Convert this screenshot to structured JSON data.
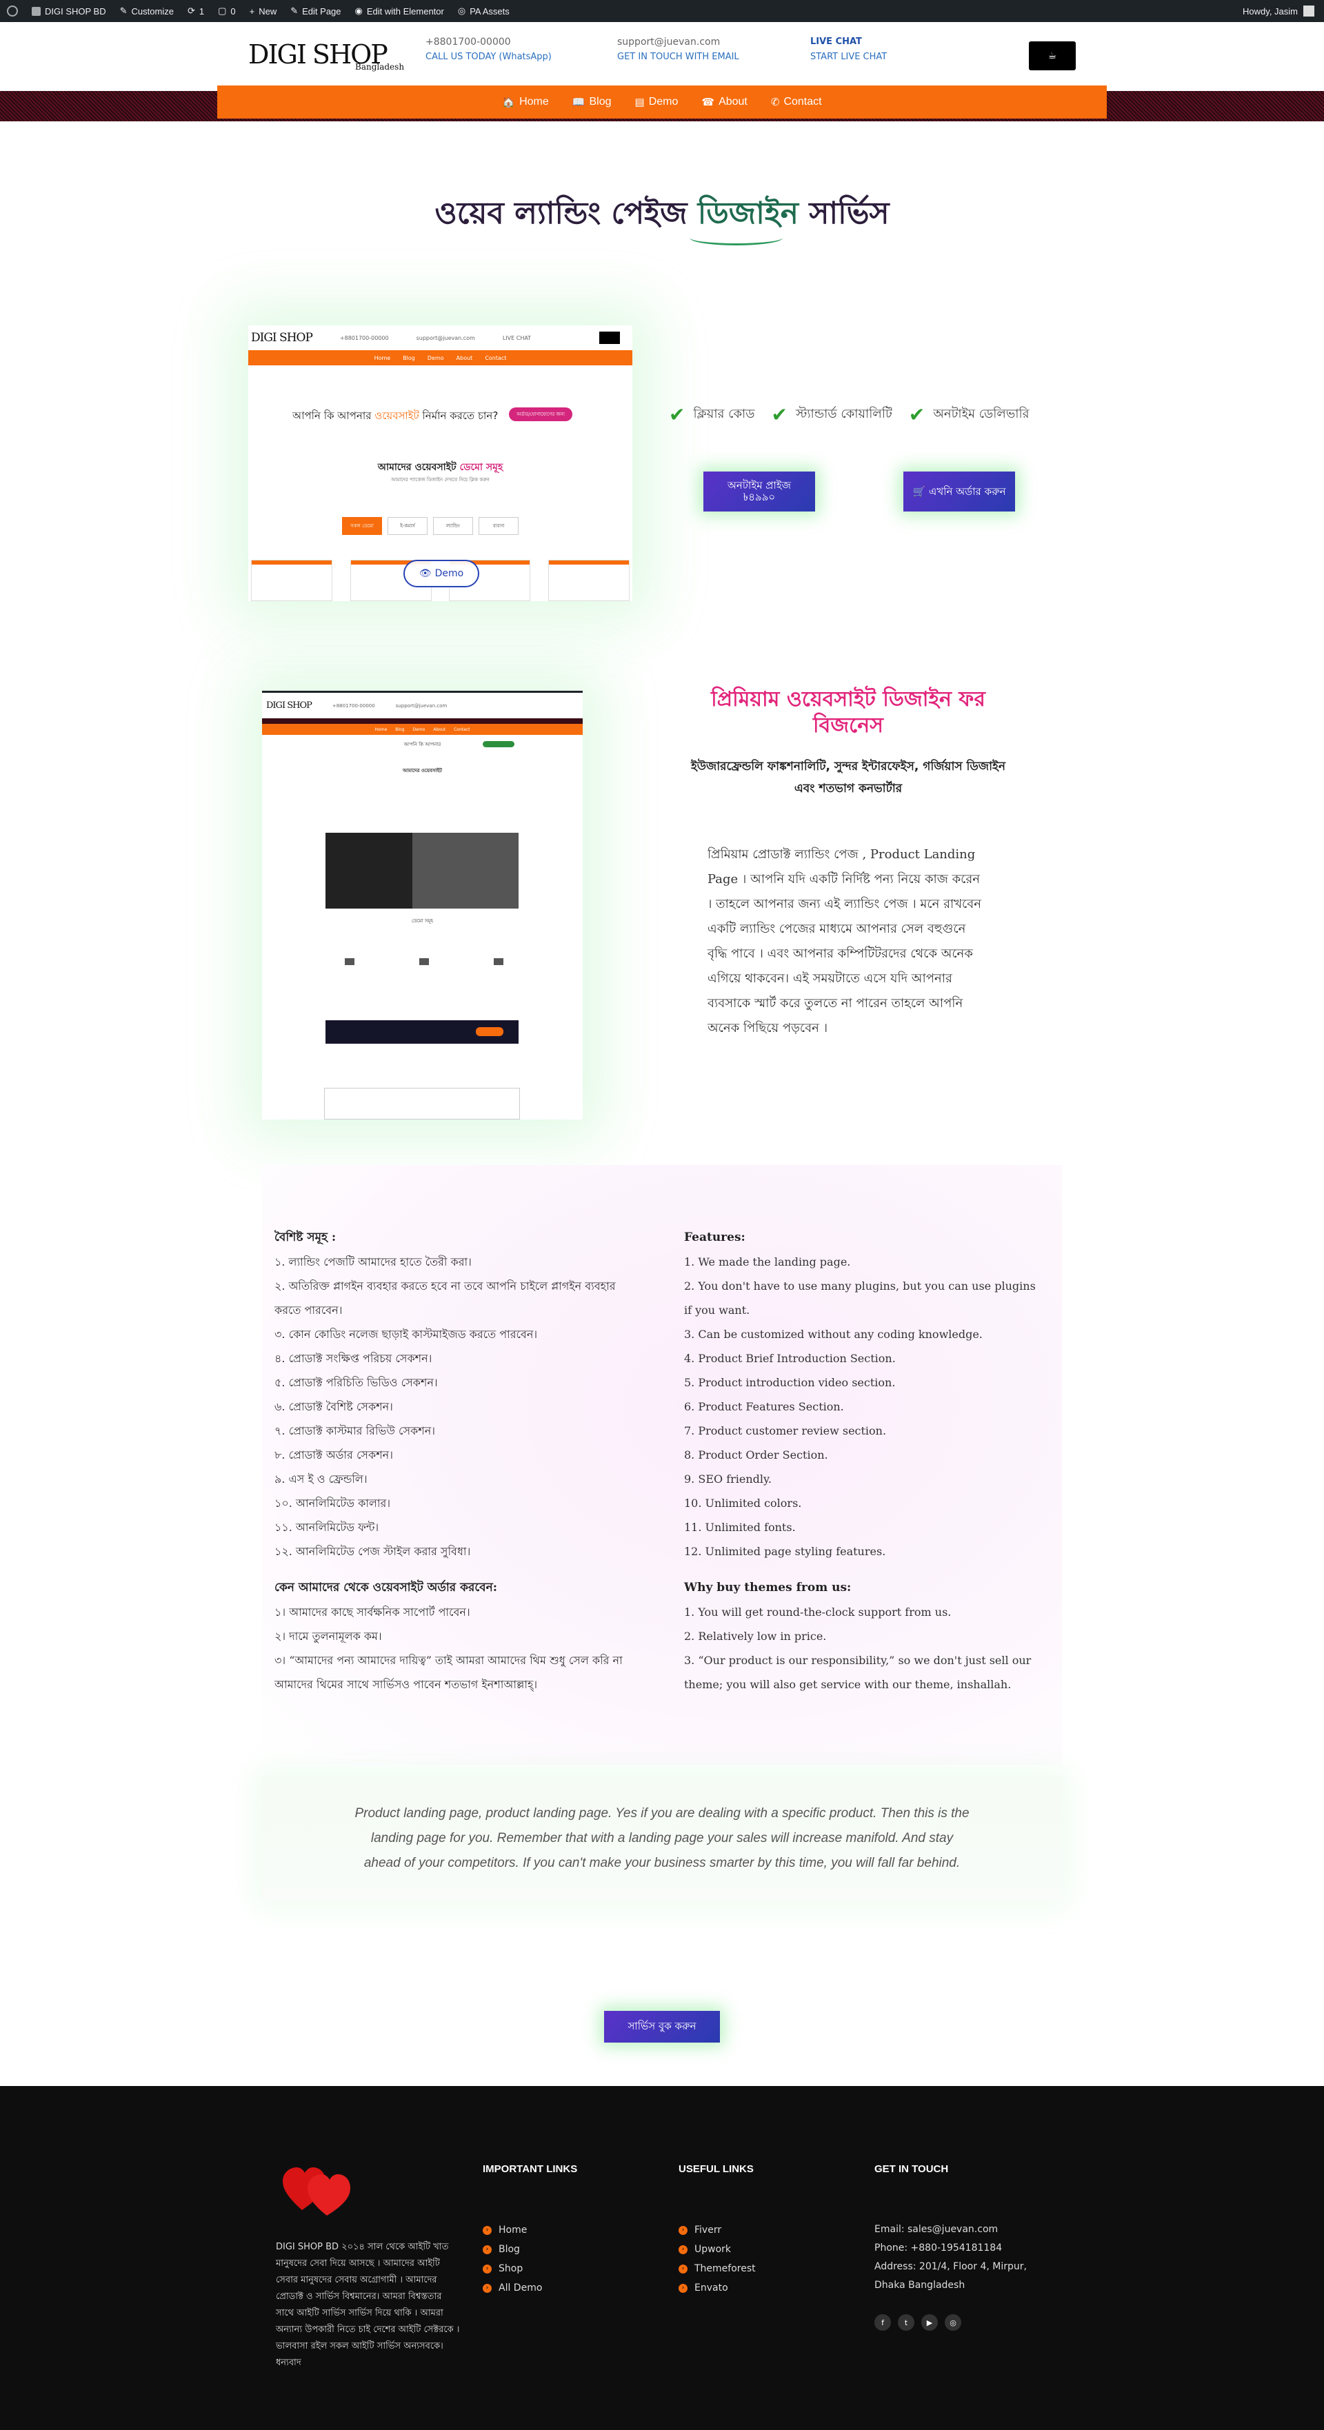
{
  "adminbar": {
    "site": "DIGI SHOP BD",
    "customize": "Customize",
    "updates": "1",
    "comments": "0",
    "new": "New",
    "edit_page": "Edit Page",
    "elementor": "Edit with Elementor",
    "pa_assets": "PA Assets",
    "howdy": "Howdy, Jasim"
  },
  "header": {
    "logo": "DIGI SHOP",
    "logo_sub": "Bangladesh",
    "phone": "+8801700-00000",
    "phone_label": "CALL US TODAY (WhatsApp)",
    "email": "support@juevan.com",
    "email_label": "GET IN TOUCH WITH EMAIL",
    "chat": "LIVE CHAT",
    "chat_label": "START LIVE CHAT"
  },
  "nav": [
    {
      "label": "Home",
      "icon": "🏠"
    },
    {
      "label": "Blog",
      "icon": "📖"
    },
    {
      "label": "Demo",
      "icon": "▤"
    },
    {
      "label": "About",
      "icon": "☎"
    },
    {
      "label": "Contact",
      "icon": "✆"
    }
  ],
  "hero": {
    "title_a": "ওয়েব ল্যান্ডিং পেইজ ",
    "title_b": "ডিজাইন",
    "title_c": " সার্ভিস"
  },
  "preview1": {
    "logo": "DIGI SHOP",
    "question_a": "আপনি কি আপনার ",
    "question_b": "ওয়েবসাইট",
    "question_c": " নির্মান করতে চান?",
    "pill": "অর্ডার/যোগাযোগের জন্য",
    "heading_a": "আমাদের ওয়েবসাইট ",
    "heading_b": "ডেমো সমূহ",
    "sub": "আমাদের প্যাকেজ ডিজাইন দেখতে নিচে ক্লিক করুন",
    "tabs": [
      "সকল ডেমো",
      "ই-কমার্স",
      "ল্যান্ডিং",
      "ব্যবসা"
    ],
    "demo_button": "Demo"
  },
  "features_row": [
    "ক্লিয়ার কোড",
    "স্ট্যান্ডার্ড কোয়ালিটি",
    "অনটাইম ডেলিভারি"
  ],
  "cta": {
    "price": "অনটাইম প্রাইজ\n৳৪৯৯০",
    "order": "এখনি অর্ডার করুন"
  },
  "section3": {
    "title": "প্রিমিয়াম ওয়েবসাইট ডিজাইন ফর বিজনেস",
    "subtitle": "ইউজারফ্রেন্ডলি ফাঙ্কশনালিটি, সুন্দর ইন্টারফেইস, গর্জিয়াস ডিজাইন এবং শতভাগ কনভার্টার",
    "body": "প্রিমিয়াম প্রোডাক্ট ল্যান্ডিং পেজ , Product Landing Page । আপনি যদি একটি নির্দিষ্ট পন্য নিয়ে কাজ করেন । তাহলে আপনার জন্য এই ল্যান্ডিং পেজ । মনে রাখবেন একটি ল্যান্ডিং পেজের মাধ্যমে আপনার সেল বহুগুনে বৃদ্ধি পাবে । এবং আপনার কম্পিটিটরদের থেকে অনেক এগিয়ে থাকবেন। এই সময়টাতে এসে যদি আপনার ব্যবসাকে স্মার্ট করে তুলতে না পারেন তাহলে আপনি অনেক পিছিয়ে পড়বেন ।"
  },
  "features_bn": {
    "title": "বৈশিষ্ট সমূহ :",
    "items": [
      "১. ল্যান্ডিং পেজটি আমাদের হাতে তৈরী করা।",
      "২. অতিরিক্ত প্লাগইন ব্যবহার করতে হবে না তবে আপনি চাইলে প্লাগইন ব্যবহার করতে পারবেন।",
      "৩. কোন কোডিং নলেজ ছাড়াই কাস্টমাইজড করতে পারবেন।",
      "৪. প্রোডাক্ট সংক্ষিপ্ত পরিচয় সেকশন।",
      "৫. প্রোডাক্ট পরিচিতি ভিডিও সেকশন।",
      "৬. প্রোডাক্ট বৈশিষ্ট সেকশন।",
      "৭. প্রোডাক্ট কাস্টমার রিভিউ সেকশন।",
      "৮. প্রোডাক্ট অর্ডার সেকশন।",
      "৯. এস ই ও ফ্রেন্ডলি।",
      "১০. আনলিমিটেড কালার।",
      "১১. আনলিমিটেড ফন্ট।",
      "১২. আনলিমিটেড পেজ স্টাইল করার সুবিধা।"
    ],
    "why_title": "কেন আমাদের থেকে ওয়েবসাইট অর্ডার করবেন:",
    "why": [
      "১। আমাদের কাছে সার্বক্ষনিক সাপোর্ট পাবেন।",
      "২। দামে তুলনামূলক কম।",
      "৩। “আমাদের পন্য আমাদের দায়িত্ব” তাই আমরা আমাদের থিম শুধু সেল করি না আমাদের থিমের সাথে সার্ভিসও পাবেন শতভাগ ইনশাআল্লাহ্‌।"
    ]
  },
  "features_en": {
    "title": "Features:",
    "items": [
      "1. We made the landing page.",
      "2. You don't have to use many plugins, but you can use plugins if you want.",
      "3. Can be customized without any coding knowledge.",
      "4. Product Brief Introduction Section.",
      "5. Product introduction video section.",
      "6. Product Features Section.",
      "7. Product customer review section.",
      "8. Product Order Section.",
      "9. SEO friendly.",
      "10. Unlimited colors.",
      "11. Unlimited fonts.",
      "12. Unlimited page styling features."
    ],
    "why_title": "Why buy themes from us:",
    "why": [
      "1. You will get round-the-clock support from us.",
      "2. Relatively low in price.",
      "3. “Our product is our responsibility,” so we don't just sell our theme; you will also get service with our theme, inshallah."
    ]
  },
  "quote": "Product landing page, product landing page. Yes if you are dealing with a specific product. Then this is the landing page for you. Remember that with a landing page your sales will increase manifold. And stay ahead of your competitors. If you can't make your business smarter by this time, you will fall far behind.",
  "book_button": "সার্ভিস বুক করুন",
  "footer": {
    "about": "DIGI SHOP BD ২০১৪ সাল থেকে আইটি খাত মানুষদের সেবা দিয়ে আসছে । আমাদের আইটি সেবার মানুষদের সেবায় অগ্রোগামী । আমাদের প্রোডাক্ট ও সার্ভিস বিশ্বমানের। আমরা বিশ্বস্ততার সাথে আইটি সার্ভিস সার্ভিস দিয়ে থাকি । আমরা অন্যান্য উপকারী নিতে চাই দেশের আইটি সেক্টরকে । ভালবাসা রইল সকল আইটি সার্ভিস অন্যসবকে। ধন্যবাদ",
    "important_title": "IMPORTANT LINKS",
    "important": [
      "Home",
      "Blog",
      "Shop",
      "All Demo"
    ],
    "useful_title": "USEFUL LINKS",
    "useful": [
      "Fiverr",
      "Upwork",
      "Themeforest",
      "Envato"
    ],
    "touch_title": "GET IN TOUCH",
    "email": "Email: sales@juevan.com",
    "phone": "Phone: +880-1954181184",
    "address": "Address: 201/4, Floor 4, Mirpur, Dhaka Bangladesh",
    "socials": [
      "facebook-icon",
      "twitter-icon",
      "youtube-icon",
      "instagram-icon"
    ]
  },
  "colors": {
    "accent_orange": "#f76c0c",
    "pink": "#e2257c",
    "green_check": "#2e9d2e",
    "button_purple": "#5a32c8",
    "footer_bg": "#0f0e0f"
  }
}
